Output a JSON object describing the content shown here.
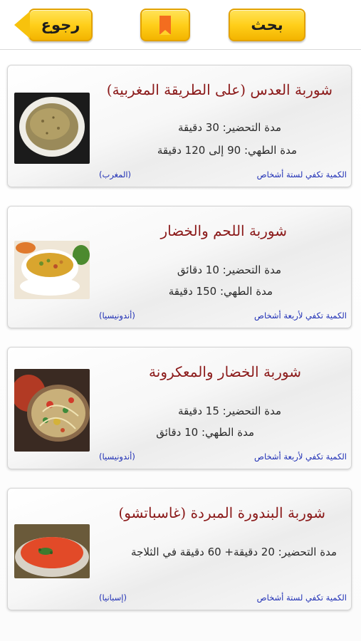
{
  "header": {
    "back_label": "رجوع",
    "search_label": "بحث",
    "bookmark_icon": "bookmark-icon"
  },
  "recipes": [
    {
      "title": "شوربة العدس (على الطريقة المغربية)",
      "prep": "مدة التحضير: 30 دقيقة",
      "cook": "مدة الطهي: 90 إلى 120 دقيقة",
      "serves": "الكمية تكفي لستة أشخاص",
      "origin": "(المغرب)"
    },
    {
      "title": "شوربة اللحم والخضار",
      "prep": "مدة التحضير: 10 دقائق",
      "cook": "مدة الطهي: 150 دقيقة",
      "serves": "الكمية تكفي لأربعة أشخاص",
      "origin": "(أندونيسيا)"
    },
    {
      "title": "شوربة الخضار والمعكرونة",
      "prep": "مدة التحضير: 15 دقيقة",
      "cook": "مدة الطهي: 10 دقائق",
      "serves": "الكمية تكفي لأربعة أشخاص",
      "origin": "(أندونيسيا)"
    },
    {
      "title": "شوربة البندورة المبردة (غاسباتشو)",
      "prep": "مدة التحضير: 20 دقيقة+ 60 دقيقة في الثلاجة",
      "serves": "الكمية تكفي لستة أشخاص",
      "origin": "(إسبانيا)"
    }
  ],
  "colors": {
    "title": "#8b1a1a",
    "link": "#1f2fb5",
    "button": "#ffcf1a"
  }
}
